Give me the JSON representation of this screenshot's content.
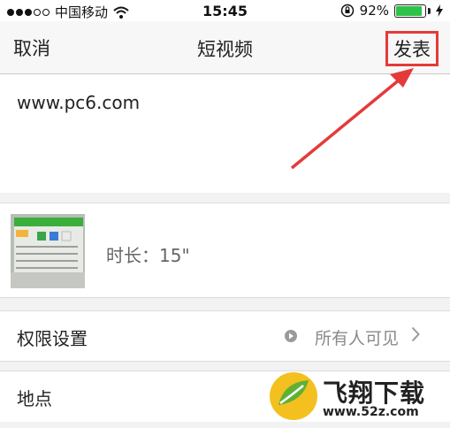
{
  "status_bar": {
    "carrier": "中国移动",
    "time": "15:45",
    "battery": "92%",
    "battery_level": 0.92
  },
  "navbar": {
    "cancel": "取消",
    "title": "短视频",
    "post": "发表"
  },
  "post": {
    "text": "www.pc6.com"
  },
  "video": {
    "duration": "时长：15\""
  },
  "settings": {
    "privacy_label": "权限设置",
    "privacy_value": "所有人可见",
    "location_label": "地点"
  },
  "watermark": {
    "brand": "飞翔下载",
    "url": "www.52z.com"
  },
  "colors": {
    "highlight": "#e53a3a",
    "battery": "#2fc24a"
  }
}
